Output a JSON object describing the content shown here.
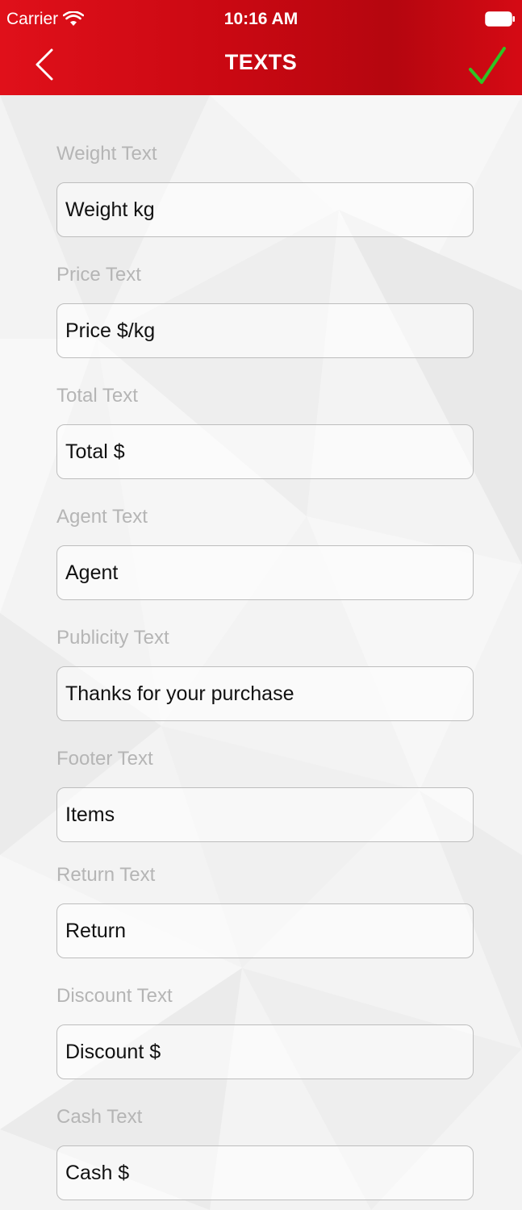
{
  "status_bar": {
    "carrier": "Carrier",
    "time": "10:16 AM"
  },
  "nav": {
    "title": "TEXTS",
    "back_icon": "chevron-left-icon",
    "save_icon": "checkmark-icon"
  },
  "colors": {
    "header_red": "#c90812",
    "check_green": "#2fc424",
    "label_gray": "#b5b5b5"
  },
  "fields": [
    {
      "label": "Weight Text",
      "value": "Weight kg"
    },
    {
      "label": "Price Text",
      "value": "Price $/kg"
    },
    {
      "label": "Total Text",
      "value": "Total $"
    },
    {
      "label": "Agent Text",
      "value": "Agent"
    },
    {
      "label": "Publicity Text",
      "value": "Thanks for your purchase"
    },
    {
      "label": "Footer Text",
      "value": "Items"
    },
    {
      "label": "Return Text",
      "value": "Return"
    },
    {
      "label": "Discount Text",
      "value": "Discount $"
    },
    {
      "label": "Cash Text",
      "value": "Cash $"
    }
  ]
}
